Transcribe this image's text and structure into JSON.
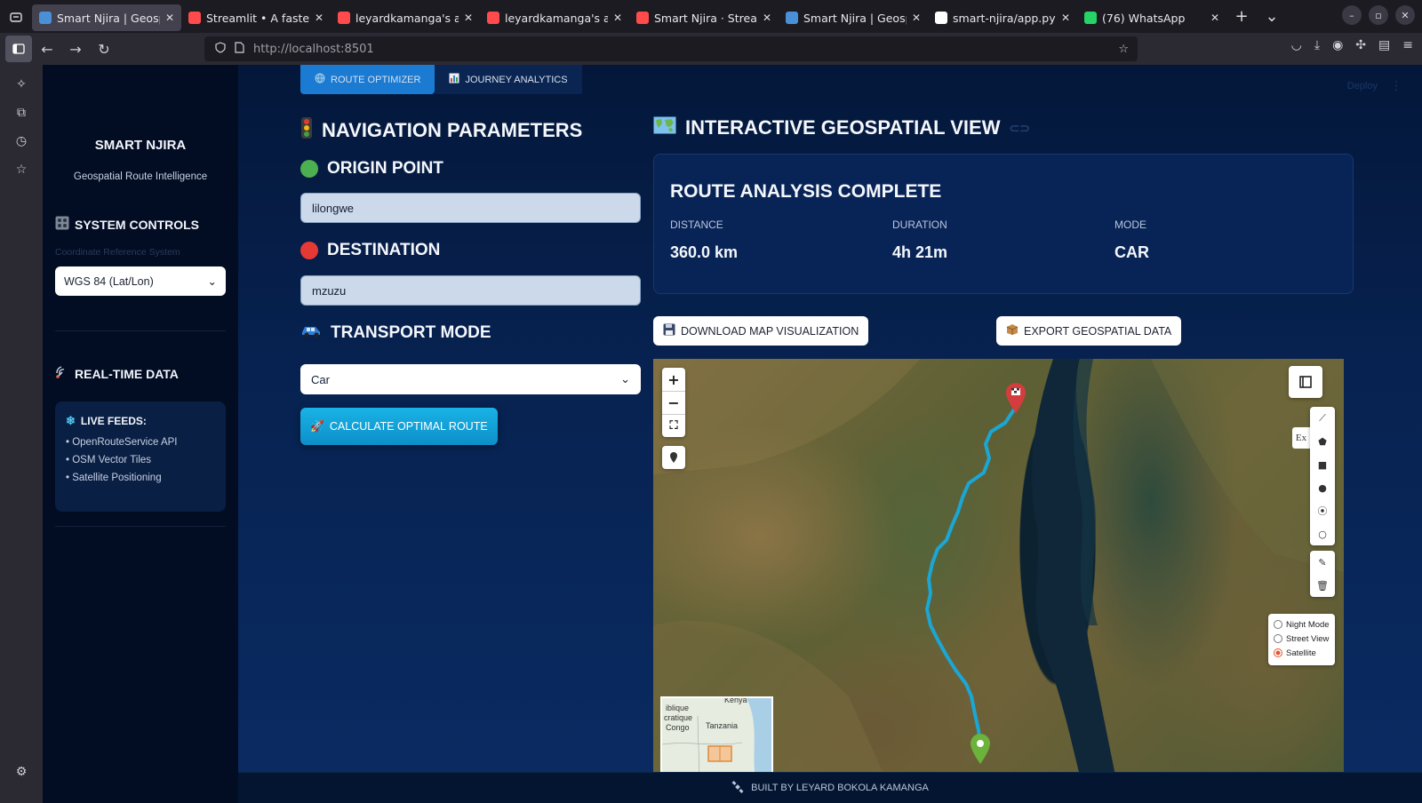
{
  "browser": {
    "tabs": [
      {
        "title": "Smart Njira | Geospat",
        "active": true,
        "favicon_color": "#4a90d9"
      },
      {
        "title": "Streamlit • A faster w",
        "active": false,
        "favicon_color": "#ff4b4b"
      },
      {
        "title": "leyardkamanga's app",
        "active": false,
        "favicon_color": "#ff4b4b"
      },
      {
        "title": "leyardkamanga's app",
        "active": false,
        "favicon_color": "#ff4b4b"
      },
      {
        "title": "Smart Njira · Streamli",
        "active": false,
        "favicon_color": "#ff4b4b"
      },
      {
        "title": "Smart Njira | Geospat",
        "active": false,
        "favicon_color": "#4a90d9"
      },
      {
        "title": "smart-njira/app.py at",
        "active": false,
        "favicon_color": "#ffffff"
      },
      {
        "title": "(76) WhatsApp",
        "active": false,
        "favicon_color": "#25d366"
      }
    ],
    "url": "http://localhost:8501"
  },
  "sidebar": {
    "brand": "SMART NJIRA",
    "tagline": "Geospatial Route Intelligence",
    "system_controls": "SYSTEM CONTROLS",
    "crs_label": "Coordinate Reference System",
    "crs_value": "WGS 84 (Lat/Lon)",
    "realtime": "REAL-TIME DATA",
    "live_feeds_title": "LIVE FEEDS:",
    "feeds": [
      "• OpenRouteService API",
      "• OSM Vector Tiles",
      "• Satellite Positioning"
    ]
  },
  "main": {
    "tabs": [
      {
        "label": "ROUTE OPTIMIZER",
        "active": true
      },
      {
        "label": "JOURNEY ANALYTICS",
        "active": false
      }
    ],
    "deploy": "Deploy",
    "nav_params": "NAVIGATION PARAMETERS",
    "origin_title": "ORIGIN POINT",
    "origin_value": "lilongwe",
    "destination_title": "DESTINATION",
    "destination_value": "mzuzu",
    "transport_title": "TRANSPORT MODE",
    "transport_value": "Car",
    "calculate_label": "CALCULATE OPTIMAL ROUTE",
    "geo_view_title": "INTERACTIVE GEOSPATIAL VIEW",
    "result": {
      "title": "ROUTE ANALYSIS COMPLETE",
      "distance_label": "DISTANCE",
      "distance_value": "360.0 km",
      "duration_label": "DURATION",
      "duration_value": "4h 21m",
      "mode_label": "MODE",
      "mode_value": "CAR"
    },
    "download_label": "DOWNLOAD MAP VISUALIZATION",
    "export_label": "EXPORT GEOSPATIAL DATA",
    "map": {
      "layers": [
        {
          "label": "Night Mode",
          "selected": false
        },
        {
          "label": "Street View",
          "selected": false
        },
        {
          "label": "Satellite",
          "selected": true
        }
      ],
      "minimap_labels": [
        "iblique",
        "cratique",
        "Congo",
        "Tanzania",
        "Kenya"
      ],
      "export_tab": "Ex",
      "route_color": "#1aa7d6"
    },
    "footer": "BUILT BY LEYARD BOKOLA KAMANGA"
  }
}
